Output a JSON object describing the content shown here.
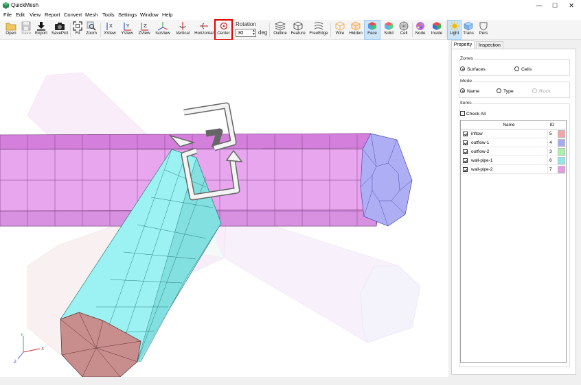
{
  "window": {
    "title": "QuickMesh",
    "minimize": "—",
    "maximize": "☐",
    "close": "✕"
  },
  "menu": [
    "File",
    "Edit",
    "View",
    "Report",
    "Convert",
    "Mesh",
    "Tools",
    "Settings",
    "Window",
    "Help"
  ],
  "toolbar": {
    "open": "Open",
    "save": "Save",
    "export": "Export",
    "savepict": "SavePict",
    "fit": "Fit",
    "zoom": "Zoom",
    "xview": "XView",
    "yview": "YView",
    "zview": "ZView",
    "isoview": "IsoView",
    "vertical": "Vertical",
    "horizontal": "Horizontal",
    "center": "Center",
    "rotation_label": "Rotation",
    "rotation_value": "30",
    "rotation_unit": "deg",
    "outline": "Outline",
    "feature": "Feature",
    "freeedge": "FreeEdge",
    "wire": "Wire",
    "hidden": "Hidden",
    "face": "Face",
    "solid": "Solid",
    "cell": "Cell",
    "node": "Node",
    "inside": "Inside",
    "light": "Light",
    "trans": "Trans",
    "pers": "Pers"
  },
  "icons": {
    "axes_x": "X",
    "axes_y": "Y",
    "axes_z": "Z"
  },
  "panel": {
    "tabs": [
      "Property",
      "Inspection"
    ],
    "zones_title": "Zones",
    "zones_surfaces": "Surfaces",
    "zones_cells": "Cells",
    "mode_title": "Mode",
    "mode_name": "Name",
    "mode_type": "Type",
    "mode_block": "Block",
    "items_title": "Items",
    "check_all": "Check All",
    "col_name": "Name",
    "col_id": "ID",
    "items": [
      {
        "name": "inflow",
        "id": "5",
        "color": "#f4a4a4",
        "checked": true
      },
      {
        "name": "outflow-1",
        "id": "4",
        "color": "#a9a9f2",
        "checked": true
      },
      {
        "name": "outflow-2",
        "id": "3",
        "color": "#a9f2a9",
        "checked": true
      },
      {
        "name": "wall-pipe-1",
        "id": "6",
        "color": "#8ee8e8",
        "checked": true
      },
      {
        "name": "wall-pipe-2",
        "id": "7",
        "color": "#e89ae8",
        "checked": true
      }
    ]
  },
  "colors": {
    "pipe_magenta": "#e6a0ea",
    "pipe_cyan": "#9cf2f2",
    "inflow_face": "#c48c8c",
    "outflow_face": "#a8a8f0",
    "ghost_pink": "#f6e2f6",
    "active_tool": "#cce4f7",
    "highlight": "#e00000"
  }
}
